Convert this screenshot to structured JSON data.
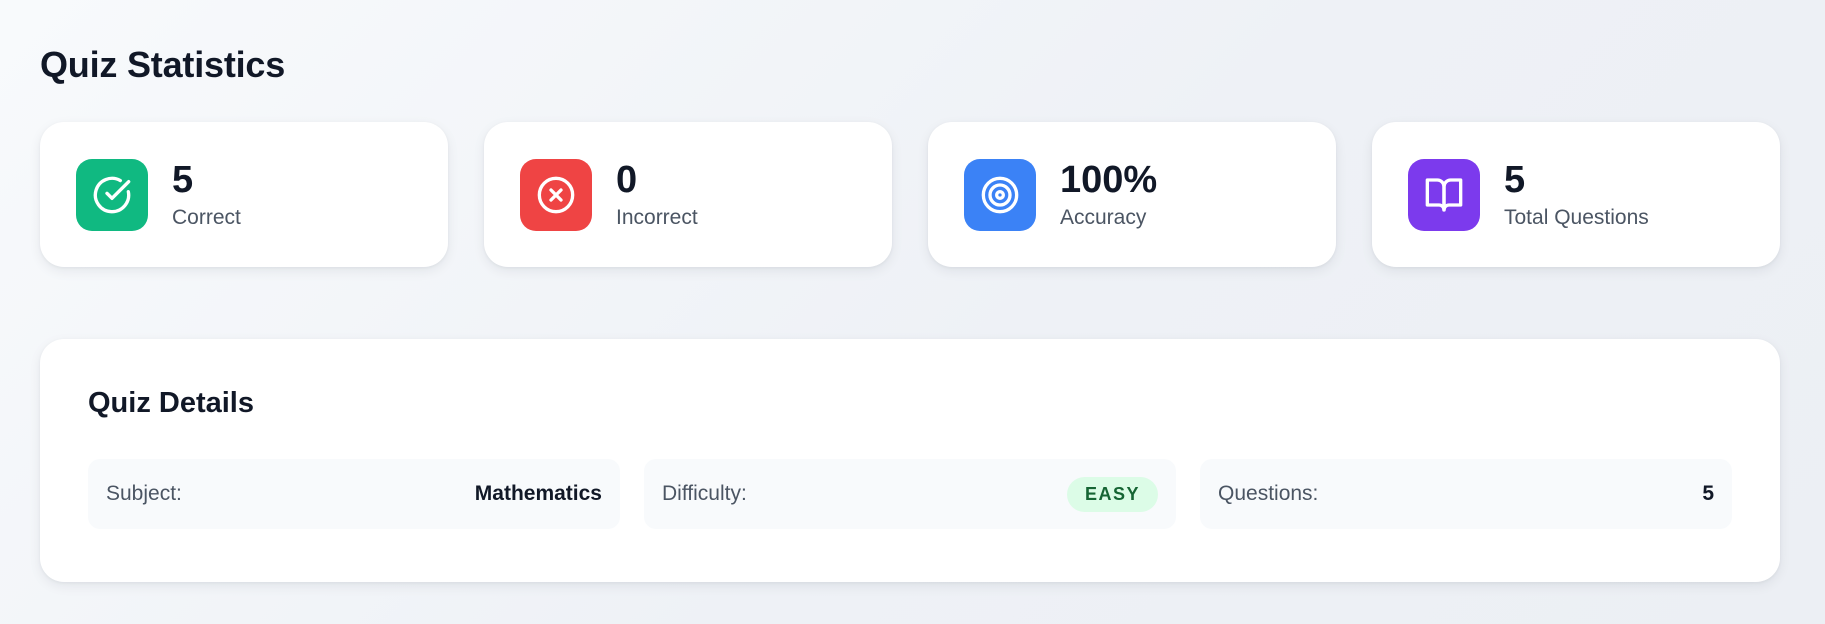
{
  "page": {
    "title": "Quiz Statistics"
  },
  "stats": [
    {
      "value": "5",
      "label": "Correct",
      "icon": "check-circle-icon",
      "color": "#10b981"
    },
    {
      "value": "0",
      "label": "Incorrect",
      "icon": "x-circle-icon",
      "color": "#ef4444"
    },
    {
      "value": "100%",
      "label": "Accuracy",
      "icon": "target-icon",
      "color": "#3b82f6"
    },
    {
      "value": "5",
      "label": "Total Questions",
      "icon": "book-open-icon",
      "color": "#7c3aed"
    }
  ],
  "details": {
    "title": "Quiz Details",
    "subject": {
      "label": "Subject:",
      "value": "Mathematics"
    },
    "difficulty": {
      "label": "Difficulty:",
      "value": "EASY",
      "badge_color": "#dcfce7",
      "text_color": "#166534"
    },
    "questions": {
      "label": "Questions:",
      "value": "5"
    }
  }
}
